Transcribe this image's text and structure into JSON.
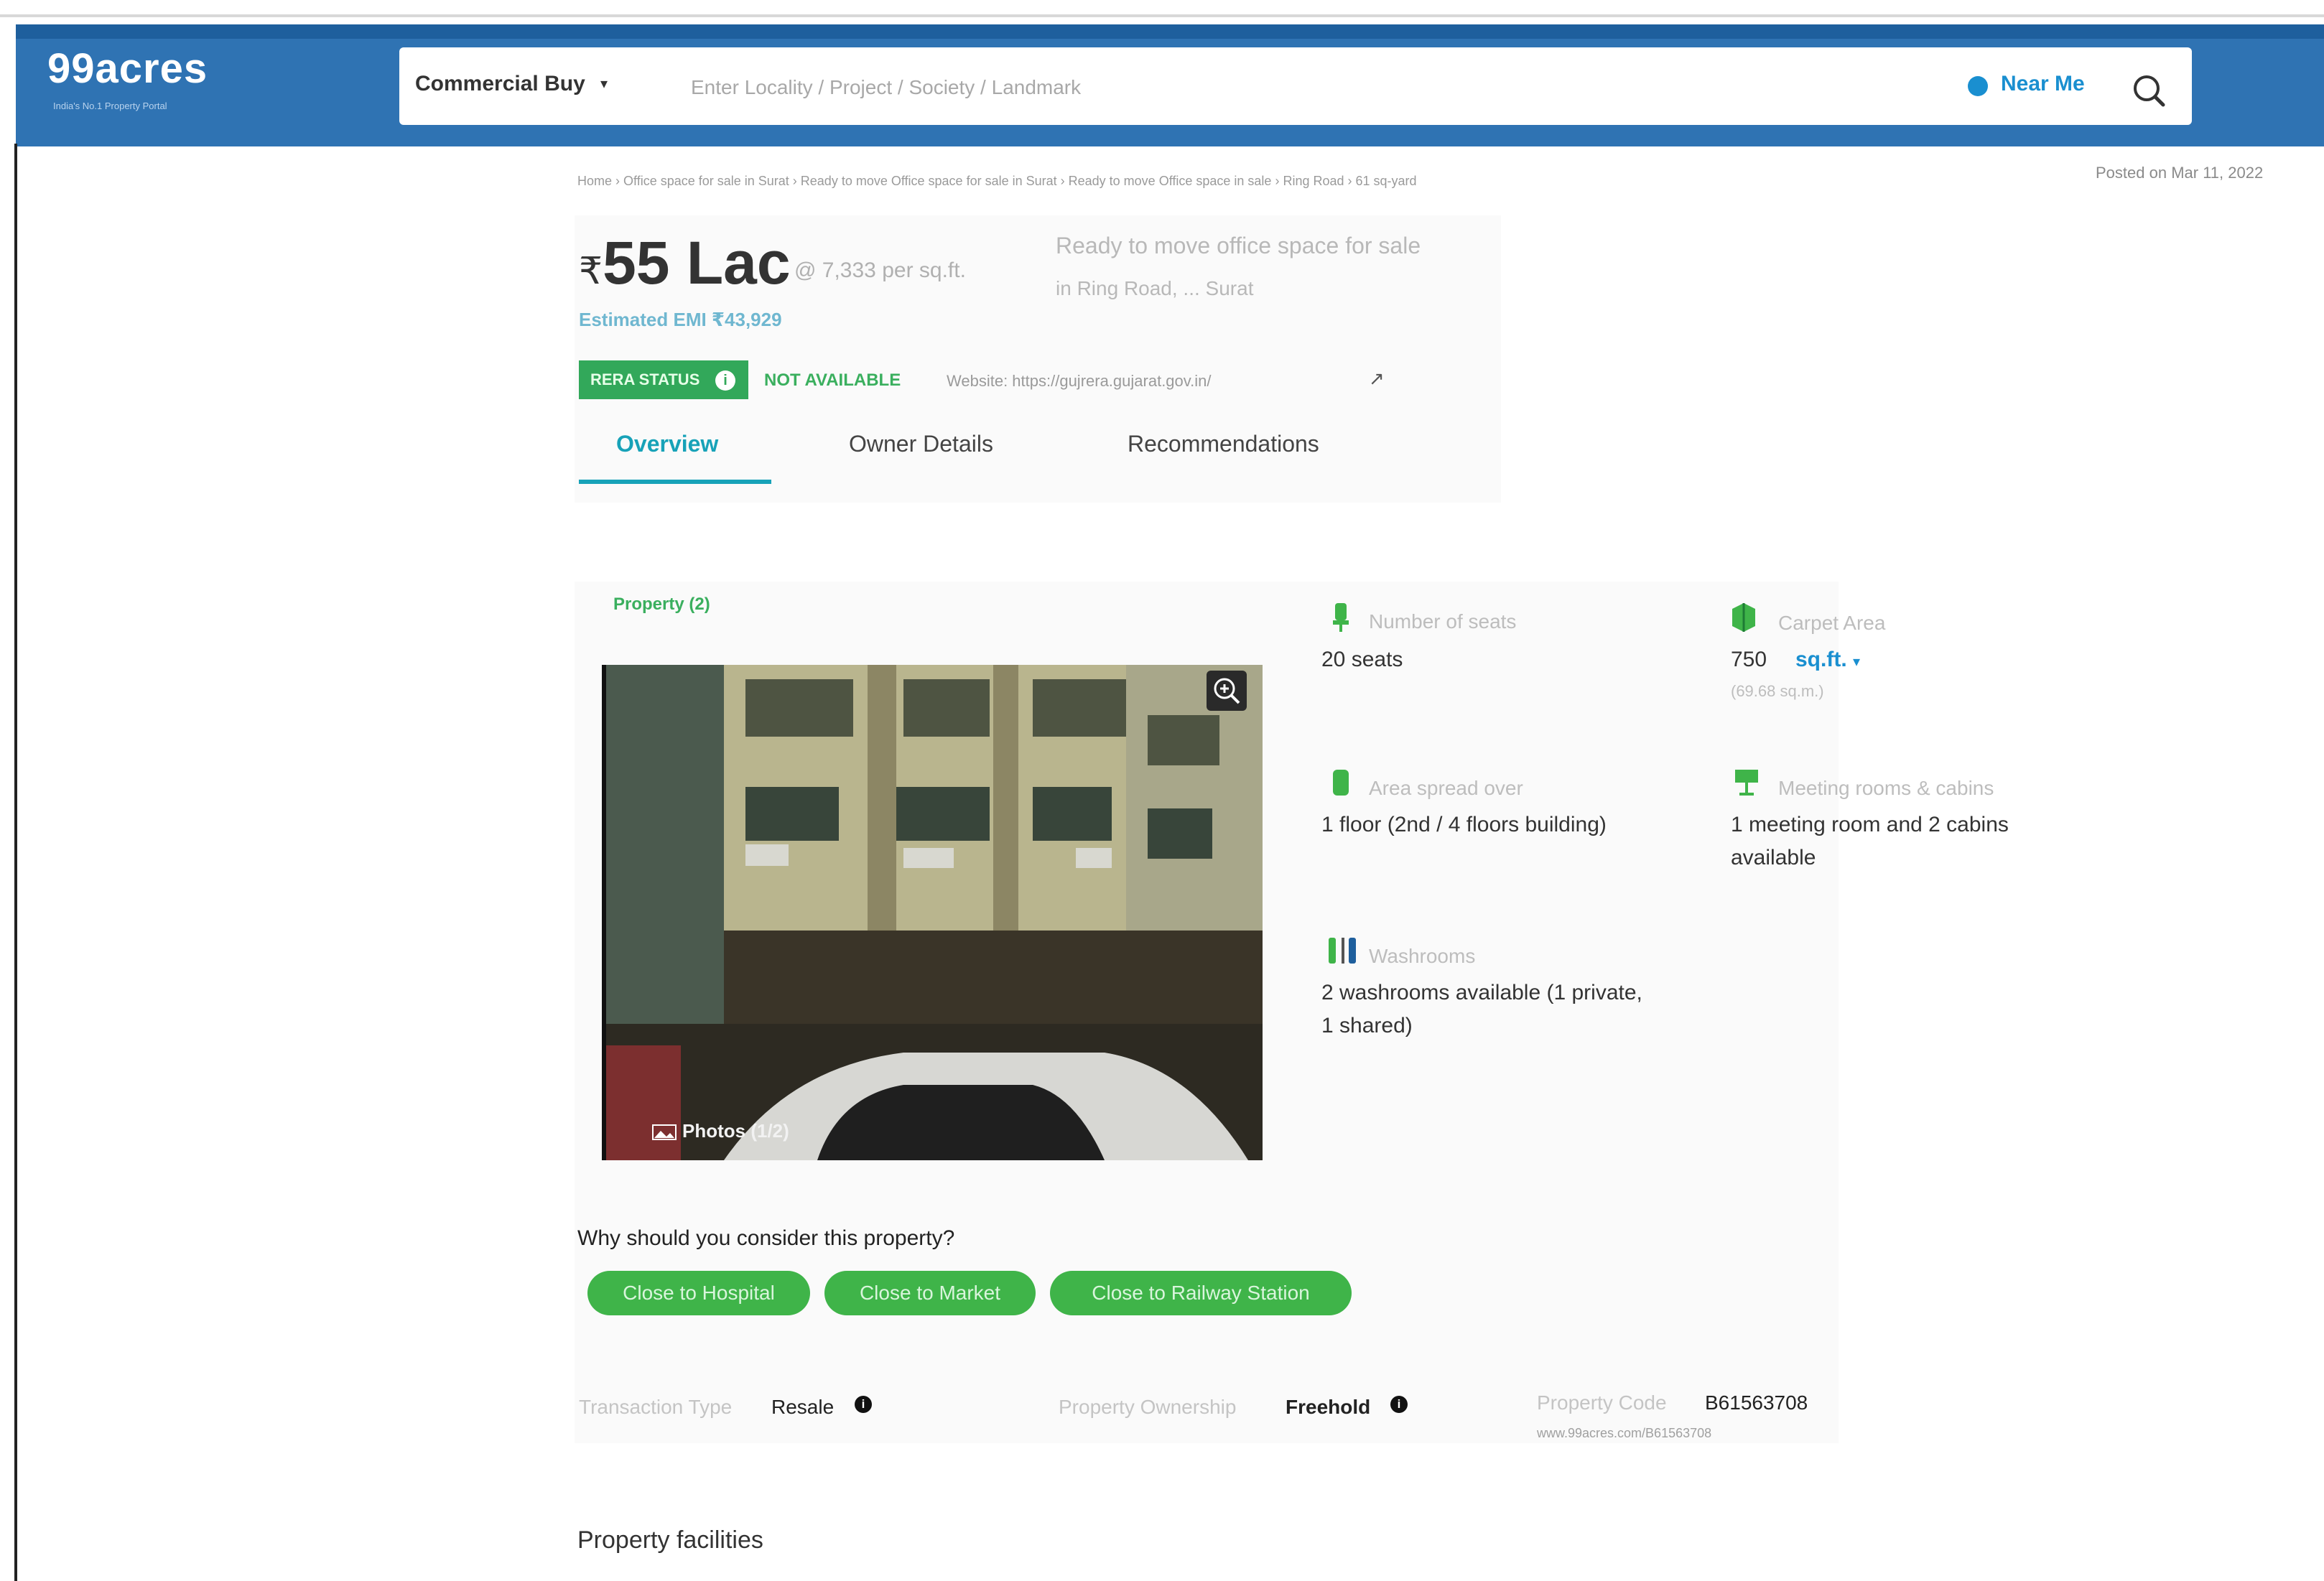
{
  "header": {
    "logo": "99acres",
    "logo_tagline": "India's No.1 Property Portal",
    "search_type": "Commercial Buy",
    "search_placeholder": "Enter Locality / Project / Society / Landmark",
    "near_me": "Near Me"
  },
  "breadcrumb": "Home › Office space for sale in Surat › Ready to move Office space for sale in Surat › Ready to move Office space in sale › Ring Road › 61 sq-yard",
  "posted": "Posted on Mar 11, 2022",
  "listing": {
    "price_symbol": "₹",
    "price": "55 Lac",
    "price_per_sqft": "@ 7,333 per sq.ft.",
    "emi": "Estimated EMI ₹43,929",
    "title_line1": "Ready to move office space for sale",
    "title_line2": "in Ring Road, ... Surat",
    "rera_label": "RERA STATUS",
    "rera_status": "NOT AVAILABLE",
    "rera_website": "Website: https://gujrera.gujarat.gov.in/"
  },
  "tabs": [
    {
      "label": "Overview",
      "active": true
    },
    {
      "label": "Owner Details",
      "active": false
    },
    {
      "label": "Recommendations",
      "active": false
    }
  ],
  "property": {
    "photo_count_label": "Property (2)",
    "photos_label": "Photos (1/2)",
    "features": [
      {
        "icon": "seat-icon",
        "label": "Number of seats",
        "value": "20 seats",
        "sub": ""
      },
      {
        "icon": "carpet-area-icon",
        "label": "Carpet Area",
        "value": "750",
        "unit": "sq.ft.",
        "sub": "(69.68 sq.m.)"
      },
      {
        "icon": "floor-icon",
        "label": "Area spread over",
        "value": "1 floor (2nd / 4 floors building)",
        "sub": ""
      },
      {
        "icon": "meeting-room-icon",
        "label": "Meeting rooms & cabins",
        "value": "1 meeting room and 2 cabins",
        "value2": "available",
        "sub": ""
      },
      {
        "icon": "washroom-icon",
        "label": "Washrooms",
        "value": "2 washrooms available (1 private,",
        "value2": "1 shared)",
        "sub": ""
      }
    ],
    "consider_heading": "Why should you consider this property?",
    "chips": [
      "Close to Hospital",
      "Close to Market",
      "Close to Railway Station"
    ],
    "transaction_label": "Transaction Type",
    "transaction_value": "Resale",
    "ownership_label": "Property Ownership",
    "ownership_value": "Freehold",
    "code_label": "Property Code",
    "code_value": "B61563708",
    "code_url": "www.99acres.com/B61563708"
  },
  "facilities_heading": "Property facilities",
  "colors": {
    "header": "#2f73b3",
    "accent_teal": "#17a2b8",
    "green": "#3fb449"
  }
}
